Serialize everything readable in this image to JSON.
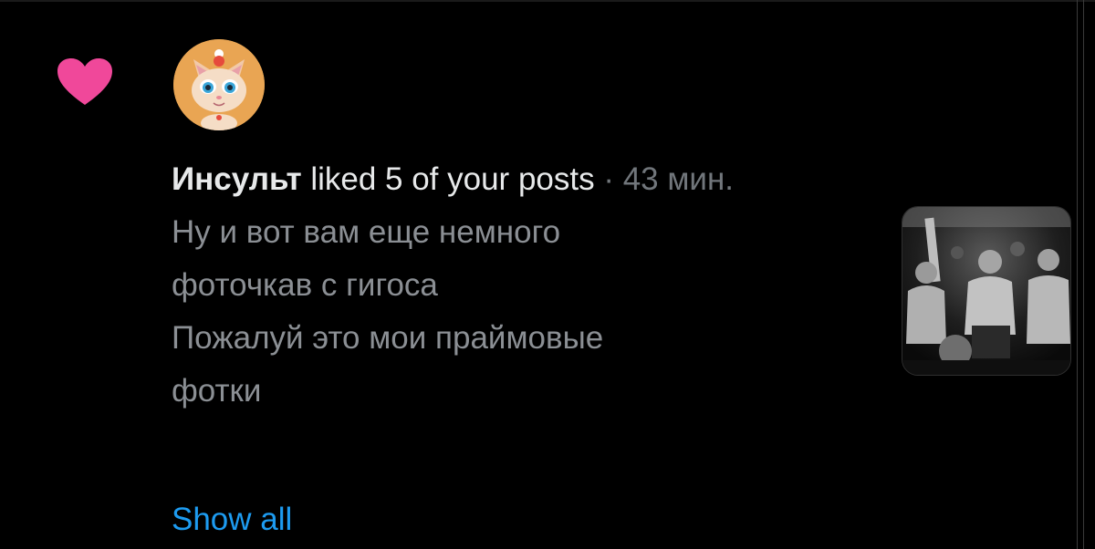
{
  "notification": {
    "icon": "heart-icon",
    "icon_color": "#f0489a",
    "avatar_icon": "cat-avatar",
    "user_name": "Инсульт",
    "action_text": " liked 5 of your posts",
    "time_text": " · 43 мин.",
    "post_text": "Ну и вот вам еще немного\nфоточкав с гигоса\nПожалуй это мои праймовые\nфотки",
    "show_all_label": "Show all",
    "thumbnail_icon": "photo-thumbnail"
  },
  "colors": {
    "background": "#000000",
    "primary_text": "#e7e9ea",
    "secondary_text": "#71767b",
    "post_text": "#8b8f94",
    "link": "#1d9bf0",
    "heart": "#f0489a"
  }
}
